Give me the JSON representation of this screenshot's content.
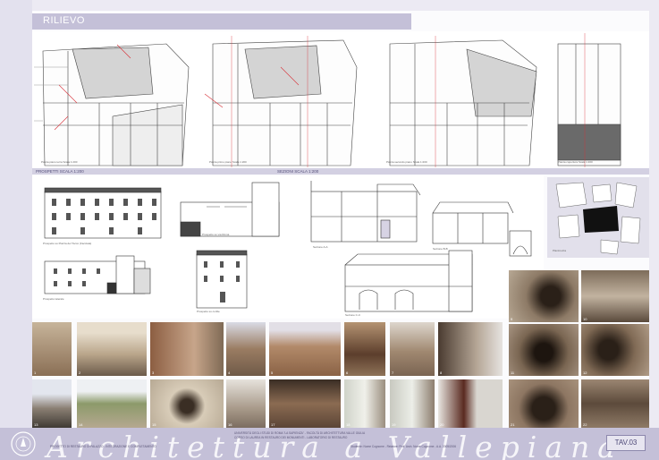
{
  "header": {
    "title": "RILIEVO"
  },
  "plans": {
    "caption_1": "Pianta piano terra Scala 1:200",
    "caption_2": "Pianta primo piano Scala 1:200",
    "caption_3": "Pianta secondo piano Scala 1:200",
    "caption_4": "Pianta copertura Scala 1:200"
  },
  "sections_bar": {
    "left": "PROSPETTI SCALA 1:200",
    "right": "SEZIONI SCALA 1:200"
  },
  "elevations": {
    "caption_1": "Prospetto su Piazza del Tocco (Facciata)",
    "caption_2": "Prospetto su via Roma",
    "caption_3": "Prospetto laterale",
    "caption_4": "Prospetto su cortile"
  },
  "sections": {
    "caption_a": "Sezione A-A",
    "caption_b": "Sezione B-B",
    "caption_c": "Sezione C-C",
    "caption_location": "Planimetria"
  },
  "photos": [
    "1",
    "2",
    "3",
    "4",
    "5",
    "6",
    "7",
    "8",
    "9",
    "10",
    "11",
    "12",
    "13",
    "14",
    "15",
    "16",
    "17",
    "18",
    "19",
    "20",
    "21",
    "22"
  ],
  "footer": {
    "brand": "Architettura a Vallepiana",
    "line_1": "UNIVERSITÀ DEGLI STUDI DI ROMA \"LA SAPIENZA\" - FACOLTÀ DI ARCHITETTURA VALLE GIULIA",
    "line_2": "CORSO DI LAUREA IN RESTAURO DEI MONUMENTI - LABORATORIO DI RESTAURO",
    "line_3": "Studente: Nome Cognome   -   Relatore: Prof. Arch. Nome Cognome   -   A.A. 2005/2006",
    "line_4": "PROGETTO DI RESTAURO DI PALAZZO - INTEGRAZIONE E COMPLETAMENTO",
    "sheet": "TAV.03"
  },
  "colors": {
    "accent": "#c4c0d8",
    "line": "#333333",
    "red": "#d8333a"
  }
}
